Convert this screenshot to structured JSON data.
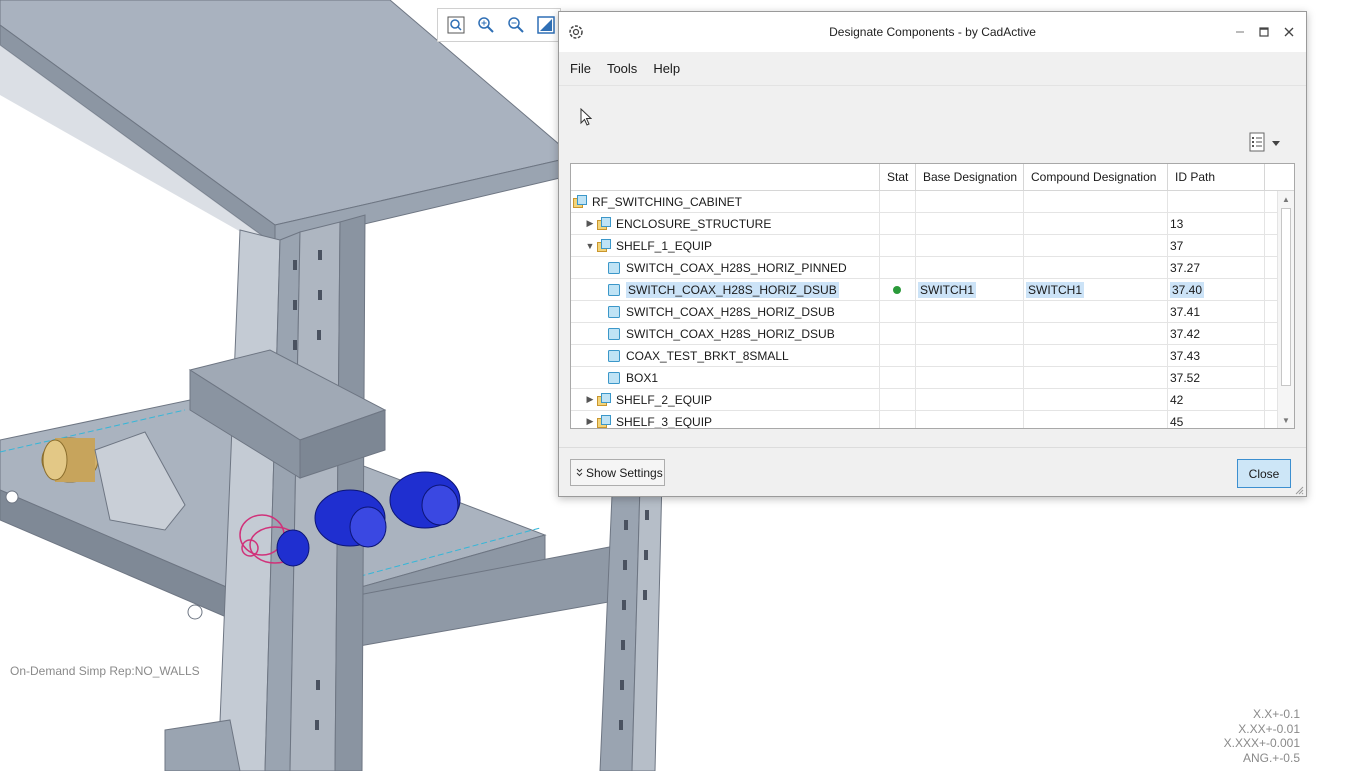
{
  "viewport": {
    "status_text": "On-Demand Simp Rep:NO_WALLS",
    "tolerances": [
      "X.X+-0.1",
      "X.XX+-0.01",
      "X.XXX+-0.001",
      "ANG.+-0.5"
    ],
    "toolbar_icons": [
      "zoom-fit-icon",
      "zoom-in-icon",
      "zoom-out-icon",
      "display-style-icon"
    ]
  },
  "dialog": {
    "title": "Designate Components - by CadActive",
    "menus": [
      "File",
      "Tools",
      "Help"
    ],
    "columns": {
      "name": "",
      "stat": "Stat",
      "base": "Base Designation",
      "compound": "Compound Designation",
      "id": "ID Path"
    },
    "rows": [
      {
        "name": "RF_SWITCHING_CABINET",
        "level": 0,
        "expander": "",
        "kind": "assembly-root",
        "stat": "",
        "base": "",
        "compound": "",
        "id": ""
      },
      {
        "name": "ENCLOSURE_STRUCTURE",
        "level": 1,
        "expander": "▶",
        "kind": "assembly",
        "stat": "",
        "base": "",
        "compound": "",
        "id": "13"
      },
      {
        "name": "SHELF_1_EQUIP",
        "level": 1,
        "expander": "▼",
        "kind": "assembly",
        "stat": "",
        "base": "",
        "compound": "",
        "id": "37"
      },
      {
        "name": "SWITCH_COAX_H28S_HORIZ_PINNED",
        "level": 2,
        "expander": "",
        "kind": "part",
        "stat": "",
        "base": "",
        "compound": "",
        "id": "37.27"
      },
      {
        "name": "SWITCH_COAX_H28S_HORIZ_DSUB",
        "level": 2,
        "expander": "",
        "kind": "part",
        "stat": "designated",
        "base": "SWITCH1",
        "compound": "SWITCH1",
        "id": "37.40",
        "selected": true
      },
      {
        "name": "SWITCH_COAX_H28S_HORIZ_DSUB",
        "level": 2,
        "expander": "",
        "kind": "part",
        "stat": "",
        "base": "",
        "compound": "",
        "id": "37.41"
      },
      {
        "name": "SWITCH_COAX_H28S_HORIZ_DSUB",
        "level": 2,
        "expander": "",
        "kind": "part",
        "stat": "",
        "base": "",
        "compound": "",
        "id": "37.42"
      },
      {
        "name": "COAX_TEST_BRKT_8SMALL",
        "level": 2,
        "expander": "",
        "kind": "part",
        "stat": "",
        "base": "",
        "compound": "",
        "id": "37.43"
      },
      {
        "name": "BOX1",
        "level": 2,
        "expander": "",
        "kind": "part",
        "stat": "",
        "base": "",
        "compound": "",
        "id": "37.52"
      },
      {
        "name": "SHELF_2_EQUIP",
        "level": 1,
        "expander": "▶",
        "kind": "assembly",
        "stat": "",
        "base": "",
        "compound": "",
        "id": "42"
      },
      {
        "name": "SHELF_3_EQUIP",
        "level": 1,
        "expander": "▶",
        "kind": "assembly",
        "stat": "",
        "base": "",
        "compound": "",
        "id": "45"
      }
    ],
    "show_settings_label": "Show Settings",
    "close_label": "Close",
    "status_color": "#2a9a3a",
    "selection_color": "#cce3f7"
  }
}
